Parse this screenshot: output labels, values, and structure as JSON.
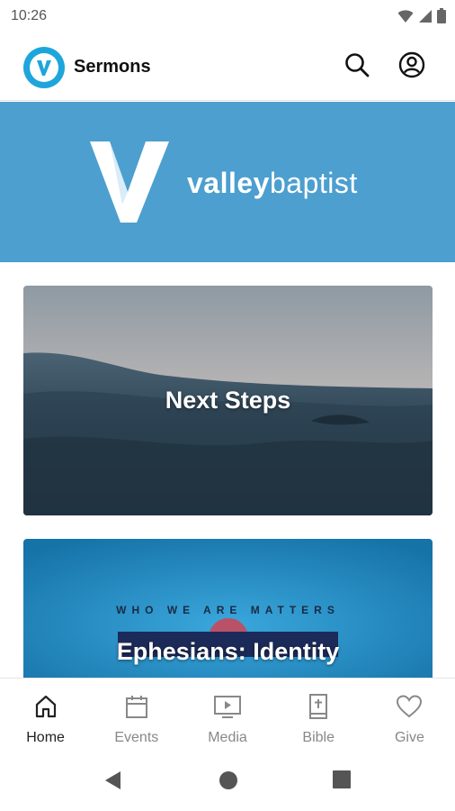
{
  "status_bar": {
    "time": "10:26",
    "icons": [
      "wifi-icon",
      "signal-icon",
      "battery-icon"
    ]
  },
  "app_bar": {
    "logo_icon": "valley-logo-icon",
    "title": "Sermons",
    "actions": [
      "search-icon",
      "account-icon"
    ]
  },
  "banner": {
    "brand_part1": "valley",
    "brand_part2": "baptist",
    "background_color": "#4c9fcf"
  },
  "cards": [
    {
      "title": "Next Steps"
    },
    {
      "title": "Ephesians: Identity",
      "artwork_tagline": "WHO WE ARE MATTERS"
    }
  ],
  "bottom_nav": {
    "items": [
      {
        "label": "Home",
        "icon": "home-icon",
        "active": true
      },
      {
        "label": "Events",
        "icon": "calendar-icon",
        "active": false
      },
      {
        "label": "Media",
        "icon": "media-icon",
        "active": false
      },
      {
        "label": "Bible",
        "icon": "bible-icon",
        "active": false
      },
      {
        "label": "Give",
        "icon": "heart-icon",
        "active": false
      }
    ]
  },
  "system_nav": [
    "back-icon",
    "home-circle-icon",
    "recents-icon"
  ],
  "colors": {
    "accent": "#1ea6dc",
    "banner": "#4c9fcf",
    "nav_active": "#222222",
    "nav_inactive": "#888888"
  }
}
